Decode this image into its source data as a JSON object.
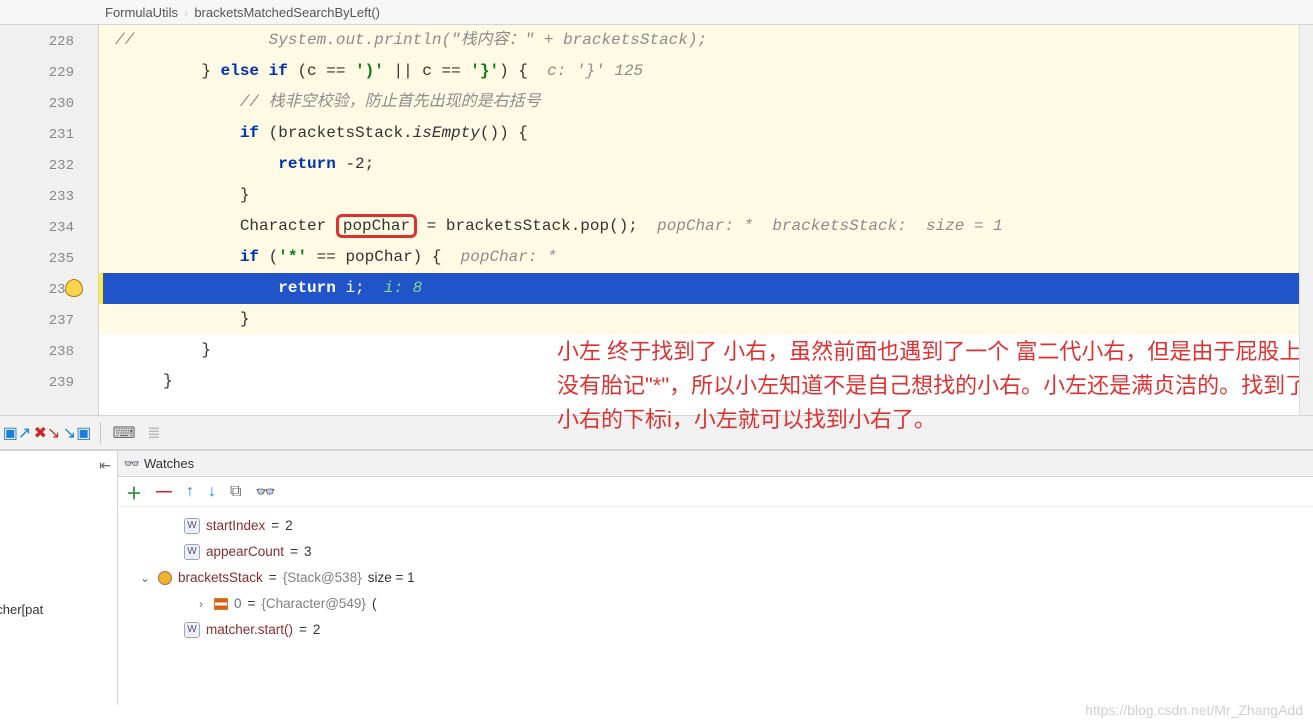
{
  "breadcrumb": {
    "class": "FormulaUtils",
    "method": "bracketsMatchedSearchByLeft()"
  },
  "gutter": [
    "228",
    "229",
    "230",
    "231",
    "232",
    "233",
    "234",
    "235",
    "236",
    "237",
    "238",
    "239"
  ],
  "code": {
    "l228_cmt_prefix": "//",
    "l228_cmt_body": "System.out.println(\"栈内容：\" + bracketsStack);",
    "l229_brace": "} ",
    "l229_else": "else if",
    "l229_cond_open": " (c == ",
    "l229_char1": "')'",
    "l229_or": " || c == ",
    "l229_char2": "'}'",
    "l229_close": ") {",
    "l229_hint": "  c: '}' 125",
    "l230_cmt": "// 栈非空校验，防止首先出现的是右括号",
    "l231_if": "if",
    "l231_body": " (bracketsStack.",
    "l231_fn": "isEmpty",
    "l231_tail": "()) {",
    "l232_return": "return",
    "l232_val": " -2;",
    "l233_brace": "}",
    "l234_type": "Character ",
    "l234_var": "popChar",
    "l234_assign": " = bracketsStack.pop();",
    "l234_hint": "  popChar: *  bracketsStack:  size = 1",
    "l235_if": "if",
    "l235_open": " (",
    "l235_char": "'*'",
    "l235_cmp": " == popChar) {",
    "l235_hint": "  popChar: *",
    "l236_return": "return",
    "l236_var": " i;",
    "l236_hint": "  i: 8",
    "l237_brace": "}",
    "l238_brace": "}",
    "l239_brace": "}"
  },
  "annotation": "小左 终于找到了 小右，虽然前面也遇到了一个 富二代小右，但是由于屁股上没有胎记\"*\"，所以小左知道不是自己想找的小右。小左还是满贞洁的。找到了小右的下标i，小左就可以找到小右了。",
  "watches_title": "Watches",
  "watches": {
    "startIndex": {
      "name": "startIndex",
      "eq": " = ",
      "val": "2"
    },
    "appearCount": {
      "name": "appearCount",
      "eq": " = ",
      "val": "3"
    },
    "bracketsStack": {
      "name": "bracketsStack",
      "eq": " = ",
      "obj": "{Stack@538}",
      "tail": " size = 1"
    },
    "elem0": {
      "idx": "0",
      "eq": " = ",
      "obj": "{Character@549}",
      "tail": " ("
    },
    "matcher": {
      "name": "matcher.start()",
      "eq": " = ",
      "val": "2"
    }
  },
  "frame_truncated": "gex.Matcher[pat",
  "watermark": "https://blog.csdn.net/Mr_ZhangAdd"
}
